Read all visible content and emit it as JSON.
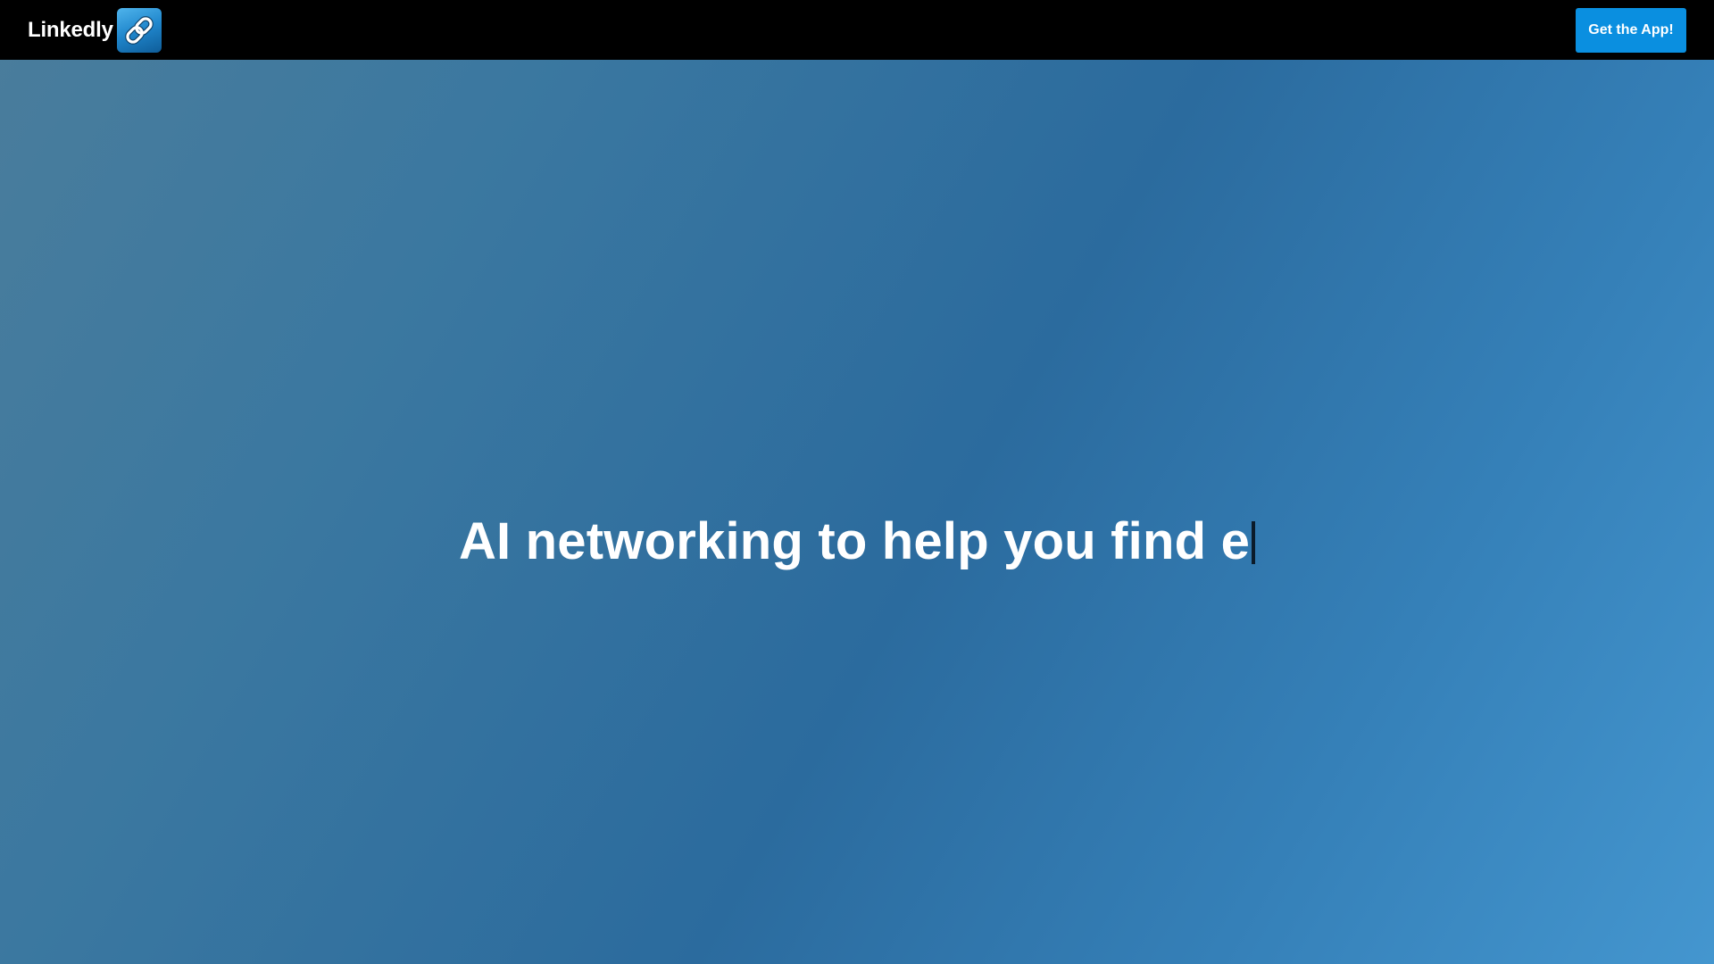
{
  "header": {
    "brand_name": "Linkedly",
    "logo_icon": "chain-link-icon",
    "cta_label": "Get the App!"
  },
  "hero": {
    "headline": "AI networking to help you find e"
  },
  "colors": {
    "topbar": "#000000",
    "cta_background": "#0a8fe0",
    "headline_text": "#ffffff",
    "background_gradient": [
      "#4a7d9c",
      "#2b6b9e",
      "#4496cf"
    ]
  }
}
